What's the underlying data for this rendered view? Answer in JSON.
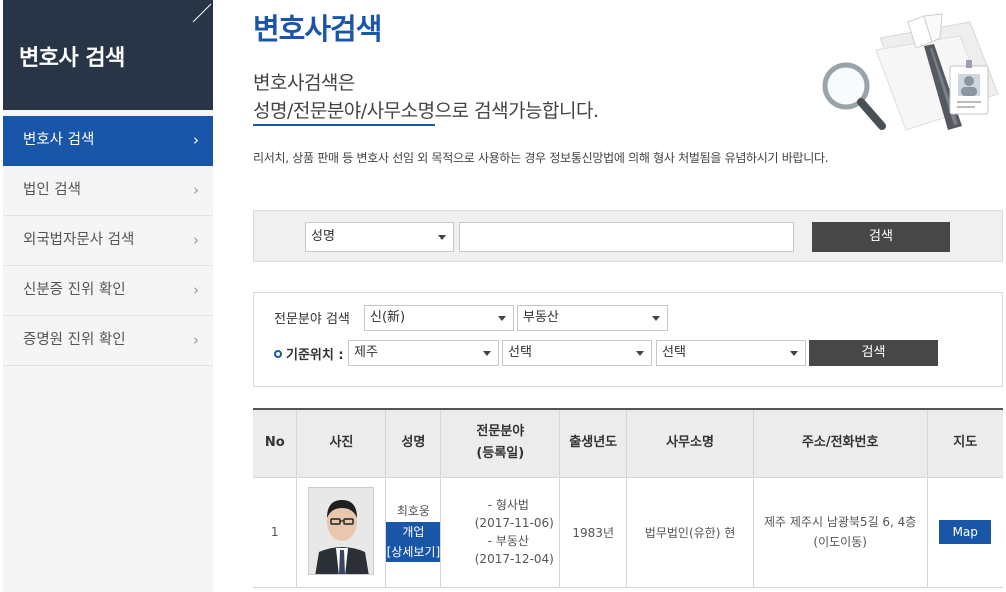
{
  "sidebar": {
    "title": "변호사 검색",
    "items": [
      {
        "label": "변호사 검색",
        "active": true
      },
      {
        "label": "법인 검색",
        "active": false
      },
      {
        "label": "외국법자문사 검색",
        "active": false
      },
      {
        "label": "신분증 진위 확인",
        "active": false
      },
      {
        "label": "증명원 진위 확인",
        "active": false
      }
    ],
    "chevron": "›"
  },
  "header": {
    "title": "변호사검색",
    "intro_line1": "변호사검색은",
    "intro_line2_underlined": "성명/전문분야/사무소명",
    "intro_line2_rest": "으로 검색가능합니다.",
    "warning": "리서치, 상품 판매 등 변호사 선임 외 목적으로 사용하는 경우 정보통신망법에 의해 형사 처벌됨을 유념하시기 바랍니다."
  },
  "search_basic": {
    "type_select": "성명",
    "query_value": "",
    "button": "검색"
  },
  "search_advanced": {
    "specialty_label": "전문분야 검색",
    "specialty_type": "신(新)",
    "specialty_field": "부동산",
    "location_label": "기준위치 :",
    "location_region": "제주",
    "location_city": "선택",
    "location_district": "선택",
    "button": "검색"
  },
  "table": {
    "headers": {
      "no": "No",
      "photo": "사진",
      "name": "성명",
      "specialty_line1": "전문분야",
      "specialty_line2": "(등록일)",
      "birth": "출생년도",
      "office": "사무소명",
      "address": "주소/전화번호",
      "map": "지도"
    },
    "rows": [
      {
        "no": "1",
        "name": "최호웅",
        "status": "개업",
        "detail": "[상세보기]",
        "specialties": [
          {
            "field": "- 형사법",
            "date": "(2017-11-06)"
          },
          {
            "field": "- 부동산",
            "date": "(2017-12-04)"
          }
        ],
        "birth": "1983년",
        "office": "법무법인(유한) 현",
        "address": "제주 제주시 남광북5길 6, 4층(이도이동)",
        "map": "Map"
      }
    ]
  },
  "colors": {
    "brand_blue": "#1a56a8",
    "sidebar_head": "#283547",
    "dark_button": "#474747"
  }
}
